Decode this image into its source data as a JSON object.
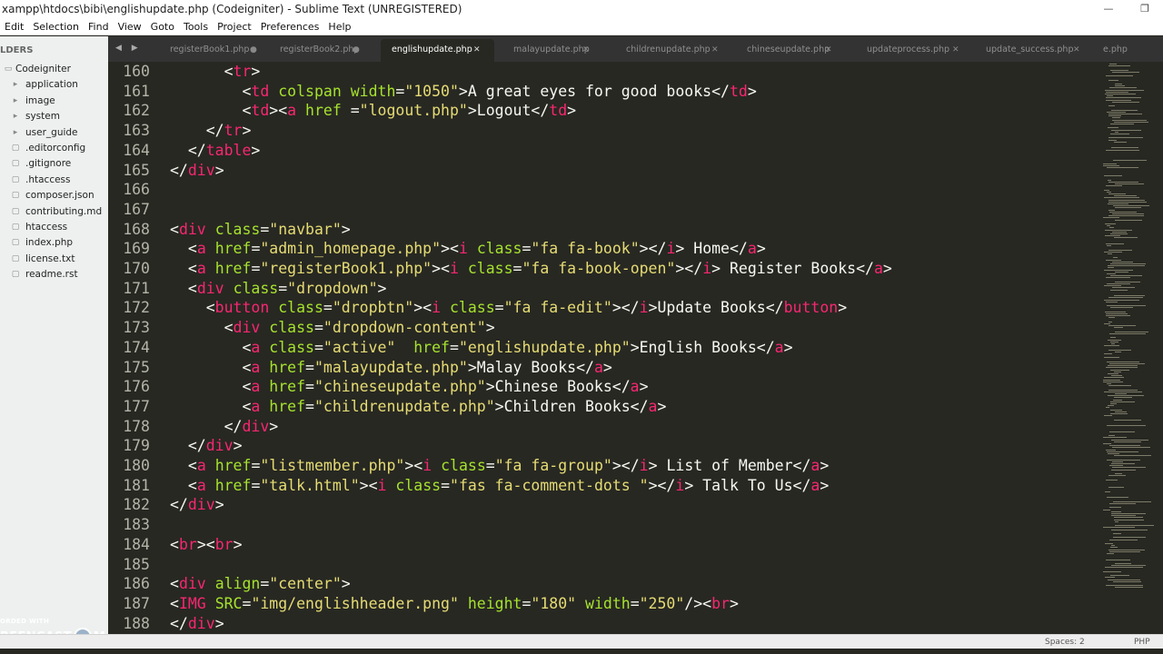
{
  "window": {
    "title": "xampp\\htdocs\\bibi\\englishupdate.php (Codeigniter) - Sublime Text (UNREGISTERED)",
    "minimize_glyph": "—",
    "restore_glyph": "❐"
  },
  "menu": [
    "Edit",
    "Selection",
    "Find",
    "View",
    "Goto",
    "Tools",
    "Project",
    "Preferences",
    "Help"
  ],
  "sidebar": {
    "header": "LDERS",
    "root": {
      "label": "Codeigniter",
      "icon": "folder-icon"
    },
    "items": [
      {
        "label": "application",
        "icon": "folder-icon"
      },
      {
        "label": "image",
        "icon": "folder-icon"
      },
      {
        "label": "system",
        "icon": "folder-icon"
      },
      {
        "label": "user_guide",
        "icon": "folder-icon"
      },
      {
        "label": ".editorconfig",
        "icon": "file-icon"
      },
      {
        "label": ".gitignore",
        "icon": "file-icon"
      },
      {
        "label": ".htaccess",
        "icon": "file-icon"
      },
      {
        "label": "composer.json",
        "icon": "file-icon"
      },
      {
        "label": "contributing.md",
        "icon": "file-icon"
      },
      {
        "label": "htaccess",
        "icon": "file-icon"
      },
      {
        "label": "index.php",
        "icon": "file-icon"
      },
      {
        "label": "license.txt",
        "icon": "file-icon"
      },
      {
        "label": "readme.rst",
        "icon": "file-icon"
      }
    ]
  },
  "tabs": {
    "nav": "◀ ▶",
    "items": [
      {
        "label": "registerBook1.php",
        "close": "●"
      },
      {
        "label": "registerBook2.php",
        "close": "●"
      },
      {
        "label": "englishupdate.php",
        "close": "✕",
        "active": true
      },
      {
        "label": "malayupdate.php",
        "close": "✕"
      },
      {
        "label": "childrenupdate.php",
        "close": "✕"
      },
      {
        "label": "chineseupdate.php",
        "close": "✕"
      },
      {
        "label": "updateprocess.php",
        "close": "✕"
      },
      {
        "label": "update_success.php",
        "close": "✕"
      },
      {
        "label": "e.php",
        "close": ""
      }
    ]
  },
  "editor": {
    "syntax_colors": {
      "tag": "#f92672",
      "attr": "#a6e22e",
      "string": "#e6db74",
      "text": "#f8f8f2",
      "background": "#272822"
    },
    "lines": [
      {
        "n": "160",
        "t": [
          [
            "      <",
            "p"
          ],
          [
            "tr",
            "tag"
          ],
          [
            ">",
            "p"
          ]
        ]
      },
      {
        "n": "161",
        "t": [
          [
            "        <",
            "p"
          ],
          [
            "td",
            "tag"
          ],
          [
            " ",
            "p"
          ],
          [
            "colspan",
            "attr"
          ],
          [
            " ",
            "p"
          ],
          [
            "width",
            "attr"
          ],
          [
            "=",
            "p"
          ],
          [
            "\"1050\"",
            "str"
          ],
          [
            ">A great eyes for good books</",
            "p"
          ],
          [
            "td",
            "tag"
          ],
          [
            ">",
            "p"
          ]
        ]
      },
      {
        "n": "162",
        "t": [
          [
            "        <",
            "p"
          ],
          [
            "td",
            "tag"
          ],
          [
            "><",
            "p"
          ],
          [
            "a",
            "tag"
          ],
          [
            " ",
            "p"
          ],
          [
            "href",
            "attr"
          ],
          [
            " =",
            "p"
          ],
          [
            "\"logout.php\"",
            "str"
          ],
          [
            ">Logout</",
            "p"
          ],
          [
            "td",
            "tag"
          ],
          [
            ">",
            "p"
          ]
        ]
      },
      {
        "n": "163",
        "t": [
          [
            "    </",
            "p"
          ],
          [
            "tr",
            "tag"
          ],
          [
            ">",
            "p"
          ]
        ]
      },
      {
        "n": "164",
        "t": [
          [
            "  </",
            "p"
          ],
          [
            "table",
            "tag"
          ],
          [
            ">",
            "p"
          ]
        ]
      },
      {
        "n": "165",
        "t": [
          [
            "</",
            "p"
          ],
          [
            "div",
            "tag"
          ],
          [
            ">",
            "p"
          ]
        ]
      },
      {
        "n": "166",
        "t": []
      },
      {
        "n": "167",
        "t": []
      },
      {
        "n": "168",
        "t": [
          [
            "<",
            "p"
          ],
          [
            "div",
            "tag"
          ],
          [
            " ",
            "p"
          ],
          [
            "class",
            "attr"
          ],
          [
            "=",
            "p"
          ],
          [
            "\"navbar\"",
            "str"
          ],
          [
            ">",
            "p"
          ]
        ]
      },
      {
        "n": "169",
        "t": [
          [
            "  <",
            "p"
          ],
          [
            "a",
            "tag"
          ],
          [
            " ",
            "p"
          ],
          [
            "href",
            "attr"
          ],
          [
            "=",
            "p"
          ],
          [
            "\"admin_homepage.php\"",
            "str"
          ],
          [
            "><",
            "p"
          ],
          [
            "i",
            "tag"
          ],
          [
            " ",
            "p"
          ],
          [
            "class",
            "attr"
          ],
          [
            "=",
            "p"
          ],
          [
            "\"fa fa-book\"",
            "str"
          ],
          [
            "></",
            "p"
          ],
          [
            "i",
            "tag"
          ],
          [
            "> Home</",
            "p"
          ],
          [
            "a",
            "tag"
          ],
          [
            ">",
            "p"
          ]
        ]
      },
      {
        "n": "170",
        "t": [
          [
            "  <",
            "p"
          ],
          [
            "a",
            "tag"
          ],
          [
            " ",
            "p"
          ],
          [
            "href",
            "attr"
          ],
          [
            "=",
            "p"
          ],
          [
            "\"registerBook1.php\"",
            "str"
          ],
          [
            "><",
            "p"
          ],
          [
            "i",
            "tag"
          ],
          [
            " ",
            "p"
          ],
          [
            "class",
            "attr"
          ],
          [
            "=",
            "p"
          ],
          [
            "\"fa fa-book-open\"",
            "str"
          ],
          [
            "></",
            "p"
          ],
          [
            "i",
            "tag"
          ],
          [
            "> Register Books</",
            "p"
          ],
          [
            "a",
            "tag"
          ],
          [
            ">",
            "p"
          ]
        ]
      },
      {
        "n": "171",
        "t": [
          [
            "  <",
            "p"
          ],
          [
            "div",
            "tag"
          ],
          [
            " ",
            "p"
          ],
          [
            "class",
            "attr"
          ],
          [
            "=",
            "p"
          ],
          [
            "\"dropdown\"",
            "str"
          ],
          [
            ">",
            "p"
          ]
        ]
      },
      {
        "n": "172",
        "t": [
          [
            "    <",
            "p"
          ],
          [
            "button",
            "tag"
          ],
          [
            " ",
            "p"
          ],
          [
            "class",
            "attr"
          ],
          [
            "=",
            "p"
          ],
          [
            "\"dropbtn\"",
            "str"
          ],
          [
            "><",
            "p"
          ],
          [
            "i",
            "tag"
          ],
          [
            " ",
            "p"
          ],
          [
            "class",
            "attr"
          ],
          [
            "=",
            "p"
          ],
          [
            "\"fa fa-edit\"",
            "str"
          ],
          [
            "></",
            "p"
          ],
          [
            "i",
            "tag"
          ],
          [
            ">Update Books</",
            "p"
          ],
          [
            "button",
            "tag"
          ],
          [
            ">",
            "p"
          ]
        ]
      },
      {
        "n": "173",
        "t": [
          [
            "      <",
            "p"
          ],
          [
            "div",
            "tag"
          ],
          [
            " ",
            "p"
          ],
          [
            "class",
            "attr"
          ],
          [
            "=",
            "p"
          ],
          [
            "\"dropdown-content\"",
            "str"
          ],
          [
            ">",
            "p"
          ]
        ]
      },
      {
        "n": "174",
        "t": [
          [
            "        <",
            "p"
          ],
          [
            "a",
            "tag"
          ],
          [
            " ",
            "p"
          ],
          [
            "class",
            "attr"
          ],
          [
            "=",
            "p"
          ],
          [
            "\"active\"",
            "str"
          ],
          [
            "  ",
            "p"
          ],
          [
            "href",
            "attr"
          ],
          [
            "=",
            "p"
          ],
          [
            "\"englishupdate.php\"",
            "str"
          ],
          [
            ">English Books</",
            "p"
          ],
          [
            "a",
            "tag"
          ],
          [
            ">",
            "p"
          ]
        ]
      },
      {
        "n": "175",
        "t": [
          [
            "        <",
            "p"
          ],
          [
            "a",
            "tag"
          ],
          [
            " ",
            "p"
          ],
          [
            "href",
            "attr"
          ],
          [
            "=",
            "p"
          ],
          [
            "\"malayupdate.php\"",
            "str"
          ],
          [
            ">Malay Books</",
            "p"
          ],
          [
            "a",
            "tag"
          ],
          [
            ">",
            "p"
          ]
        ]
      },
      {
        "n": "176",
        "t": [
          [
            "        <",
            "p"
          ],
          [
            "a",
            "tag"
          ],
          [
            " ",
            "p"
          ],
          [
            "href",
            "attr"
          ],
          [
            "=",
            "p"
          ],
          [
            "\"chineseupdate.php\"",
            "str"
          ],
          [
            ">Chinese Books</",
            "p"
          ],
          [
            "a",
            "tag"
          ],
          [
            ">",
            "p"
          ]
        ]
      },
      {
        "n": "177",
        "t": [
          [
            "        <",
            "p"
          ],
          [
            "a",
            "tag"
          ],
          [
            " ",
            "p"
          ],
          [
            "href",
            "attr"
          ],
          [
            "=",
            "p"
          ],
          [
            "\"childrenupdate.php\"",
            "str"
          ],
          [
            ">Children Books</",
            "p"
          ],
          [
            "a",
            "tag"
          ],
          [
            ">",
            "p"
          ]
        ]
      },
      {
        "n": "178",
        "t": [
          [
            "      </",
            "p"
          ],
          [
            "div",
            "tag"
          ],
          [
            ">",
            "p"
          ]
        ]
      },
      {
        "n": "179",
        "t": [
          [
            "  </",
            "p"
          ],
          [
            "div",
            "tag"
          ],
          [
            ">",
            "p"
          ]
        ]
      },
      {
        "n": "180",
        "t": [
          [
            "  <",
            "p"
          ],
          [
            "a",
            "tag"
          ],
          [
            " ",
            "p"
          ],
          [
            "href",
            "attr"
          ],
          [
            "=",
            "p"
          ],
          [
            "\"listmember.php\"",
            "str"
          ],
          [
            "><",
            "p"
          ],
          [
            "i",
            "tag"
          ],
          [
            " ",
            "p"
          ],
          [
            "class",
            "attr"
          ],
          [
            "=",
            "p"
          ],
          [
            "\"fa fa-group\"",
            "str"
          ],
          [
            "></",
            "p"
          ],
          [
            "i",
            "tag"
          ],
          [
            "> List of Member</",
            "p"
          ],
          [
            "a",
            "tag"
          ],
          [
            ">",
            "p"
          ]
        ]
      },
      {
        "n": "181",
        "t": [
          [
            "  <",
            "p"
          ],
          [
            "a",
            "tag"
          ],
          [
            " ",
            "p"
          ],
          [
            "href",
            "attr"
          ],
          [
            "=",
            "p"
          ],
          [
            "\"talk.html\"",
            "str"
          ],
          [
            "><",
            "p"
          ],
          [
            "i",
            "tag"
          ],
          [
            " ",
            "p"
          ],
          [
            "class",
            "attr"
          ],
          [
            "=",
            "p"
          ],
          [
            "\"fas fa-comment-dots \"",
            "str"
          ],
          [
            "></",
            "p"
          ],
          [
            "i",
            "tag"
          ],
          [
            "> Talk To Us</",
            "p"
          ],
          [
            "a",
            "tag"
          ],
          [
            ">",
            "p"
          ]
        ]
      },
      {
        "n": "182",
        "t": [
          [
            "</",
            "p"
          ],
          [
            "div",
            "tag"
          ],
          [
            ">",
            "p"
          ]
        ]
      },
      {
        "n": "183",
        "t": []
      },
      {
        "n": "184",
        "t": [
          [
            "<",
            "p"
          ],
          [
            "br",
            "tag"
          ],
          [
            "><",
            "p"
          ],
          [
            "br",
            "tag"
          ],
          [
            ">",
            "p"
          ]
        ]
      },
      {
        "n": "185",
        "t": []
      },
      {
        "n": "186",
        "t": [
          [
            "<",
            "p"
          ],
          [
            "div",
            "tag"
          ],
          [
            " ",
            "p"
          ],
          [
            "align",
            "attr"
          ],
          [
            "=",
            "p"
          ],
          [
            "\"center\"",
            "str"
          ],
          [
            ">",
            "p"
          ]
        ]
      },
      {
        "n": "187",
        "t": [
          [
            "<",
            "p"
          ],
          [
            "IMG",
            "tag"
          ],
          [
            " ",
            "p"
          ],
          [
            "SRC",
            "attr"
          ],
          [
            "=",
            "p"
          ],
          [
            "\"img/englishheader.png\"",
            "str"
          ],
          [
            " ",
            "p"
          ],
          [
            "height",
            "attr"
          ],
          [
            "=",
            "p"
          ],
          [
            "\"180\"",
            "str"
          ],
          [
            " ",
            "p"
          ],
          [
            "width",
            "attr"
          ],
          [
            "=",
            "p"
          ],
          [
            "\"250\"",
            "str"
          ],
          [
            "/><",
            "p"
          ],
          [
            "br",
            "tag"
          ],
          [
            ">",
            "p"
          ]
        ]
      },
      {
        "n": "188",
        "t": [
          [
            "</",
            "p"
          ],
          [
            "div",
            "tag"
          ],
          [
            ">",
            "p"
          ]
        ]
      }
    ]
  },
  "statusbar": {
    "spaces": "Spaces: 2",
    "syntax": "PHP"
  },
  "watermark": {
    "top": "ORDED WITH",
    "left": "REENCAST",
    "right": "MATIC"
  }
}
